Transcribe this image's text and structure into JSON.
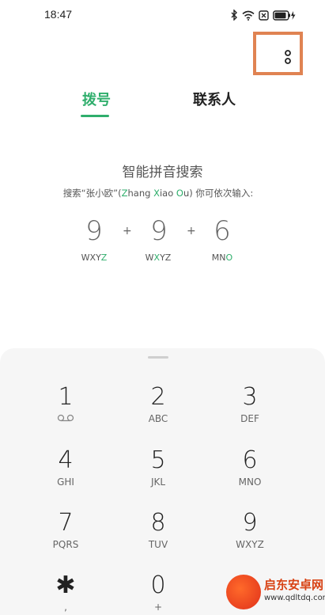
{
  "status_bar": {
    "time": "18:47",
    "icons": [
      "bluetooth-icon",
      "wifi-icon",
      "no-sim-icon",
      "battery-charging-icon"
    ]
  },
  "header": {
    "more_icon": "more-vertical-icon",
    "highlight_color": "#e08352"
  },
  "tabs": [
    {
      "label": "拨号",
      "active": true
    },
    {
      "label": "联系人",
      "active": false
    }
  ],
  "accent_color": "#2fae6c",
  "pinyin_search": {
    "title": "智能拼音搜索",
    "desc_prefix": "搜索“张小欧”(",
    "desc_z": "Z",
    "desc_hang": "hang ",
    "desc_x": "X",
    "desc_iao": "iao ",
    "desc_o": "O",
    "desc_u": "u",
    "desc_suffix": ") 你可依次输入:",
    "example": [
      {
        "digit": "9",
        "letters_pre": "WXY",
        "letters_hl": "Z",
        "letters_post": ""
      },
      {
        "digit": "9",
        "letters_pre": "W",
        "letters_hl": "X",
        "letters_post": "YZ"
      },
      {
        "digit": "6",
        "letters_pre": "MN",
        "letters_hl": "O",
        "letters_post": ""
      }
    ],
    "plus": "+"
  },
  "keypad": {
    "keys": [
      {
        "num": "1",
        "sub": "",
        "sub_icon": "voicemail-icon"
      },
      {
        "num": "2",
        "sub": "ABC"
      },
      {
        "num": "3",
        "sub": "DEF"
      },
      {
        "num": "4",
        "sub": "GHI"
      },
      {
        "num": "5",
        "sub": "JKL"
      },
      {
        "num": "6",
        "sub": "MNO"
      },
      {
        "num": "7",
        "sub": "PQRS"
      },
      {
        "num": "8",
        "sub": "TUV"
      },
      {
        "num": "9",
        "sub": "WXYZ"
      },
      {
        "num": "✱",
        "sub": ","
      },
      {
        "num": "0",
        "sub": "+"
      }
    ]
  },
  "watermark": {
    "title": "启东安卓网",
    "url": "www.qdltdq.com"
  }
}
